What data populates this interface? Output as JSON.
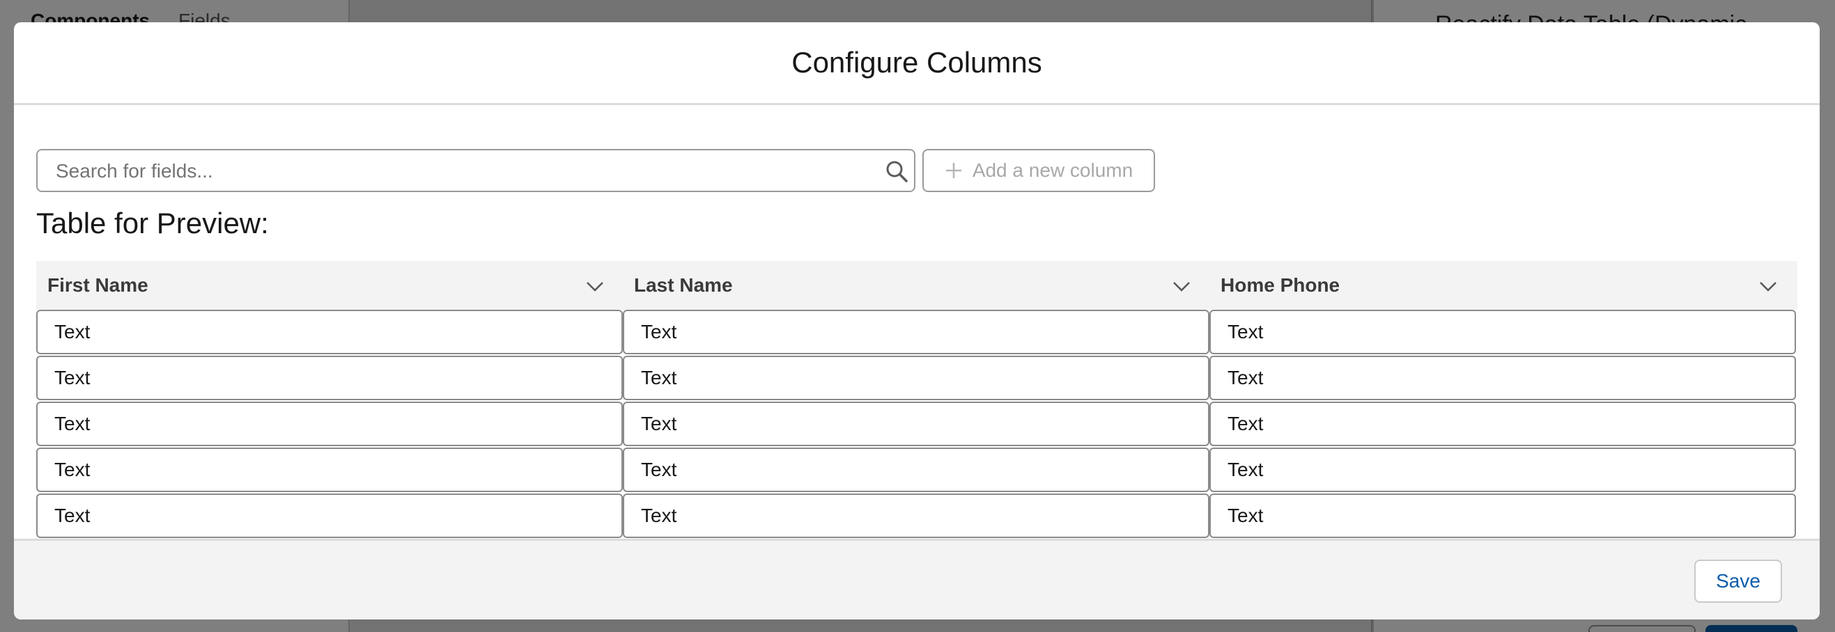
{
  "background": {
    "left_tabs": [
      "Components",
      "Fields"
    ],
    "right_panel_title": "Reactify Data Table (Dynamic"
  },
  "modal": {
    "title": "Configure Columns",
    "search": {
      "placeholder": "Search for fields...",
      "value": "",
      "icon": "search-icon"
    },
    "add_column": {
      "label": "Add a new column",
      "icon": "plus-icon",
      "disabled": true
    },
    "preview_heading": "Table for Preview:",
    "table": {
      "columns": [
        {
          "label": "First Name",
          "icon": "chevron-down-icon"
        },
        {
          "label": "Last Name",
          "icon": "chevron-down-icon"
        },
        {
          "label": "Home Phone",
          "icon": "chevron-down-icon"
        }
      ],
      "rows": [
        [
          "Text",
          "Text",
          "Text"
        ],
        [
          "Text",
          "Text",
          "Text"
        ],
        [
          "Text",
          "Text",
          "Text"
        ],
        [
          "Text",
          "Text",
          "Text"
        ],
        [
          "Text",
          "Text",
          "Text"
        ]
      ]
    },
    "footer": {
      "save_label": "Save"
    }
  },
  "colors": {
    "accent": "#0b5cab",
    "backdrop": "rgba(0,0,0,0.5)",
    "header_bg": "#f3f3f3",
    "border": "#8a8a8a"
  }
}
